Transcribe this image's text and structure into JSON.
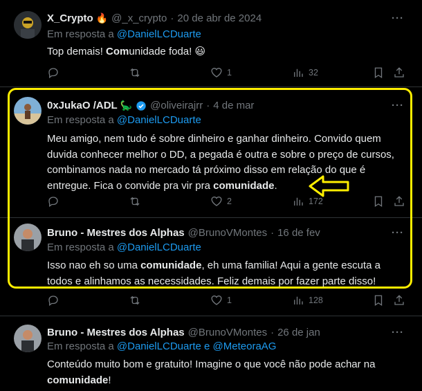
{
  "tweets": [
    {
      "name": "X_Crypto",
      "name_emoji": "🔥",
      "handle": "@_x_crypto",
      "sep": "·",
      "date": "20 de abr de 2024",
      "reply_prefix": "Em resposta a",
      "reply_to": "@DanielLCDuarte",
      "text_pre": "Top demais! ",
      "text_bold": "Com",
      "text_post": "unidade foda! 😃",
      "likes": "1",
      "views": "32"
    },
    {
      "name": "0xJukaO /ADL",
      "name_emoji": "🦕",
      "handle": "@oliveirajrr",
      "sep": "·",
      "date": "4 de mar",
      "reply_prefix": "Em resposta a",
      "reply_to": "@DanielLCDuarte",
      "text_pre": "Meu amigo, nem tudo é sobre dinheiro e ganhar dinheiro. Convido quem duvida conhecer melhor o DD, a pegada é outra e sobre o preço de cursos, combinamos nada no mercado tá próximo disso em relação do que é entregue. Fica o convide pra vir pra ",
      "text_bold": "comunidade",
      "text_post": ".",
      "likes": "2",
      "views": "172"
    },
    {
      "name": "Bruno - Mestres dos Alphas",
      "handle": "@BrunoVMontes",
      "sep": "·",
      "date": "16 de fev",
      "reply_prefix": "Em resposta a",
      "reply_to": "@DanielLCDuarte",
      "text_pre": "Isso nao eh so uma ",
      "text_bold": "comunidade",
      "text_post": ", eh uma familia! Aqui a gente escuta a todos e alinhamos as necessidades. Feliz demais por fazer parte disso!",
      "likes": "1",
      "views": "128"
    },
    {
      "name": "Bruno - Mestres dos Alphas",
      "handle": "@BrunoVMontes",
      "sep": "·",
      "date": "26 de jan",
      "reply_prefix": "Em resposta a",
      "reply_to": "@DanielLCDuarte",
      "reply_and": "e",
      "reply_to_2": "@MeteoraAG",
      "text_pre": "Conteúdo muito bom e gratuito! Imagine o que você não pode achar na ",
      "text_bold": "comunidade",
      "text_post": "!"
    }
  ],
  "more_glyph": "···",
  "colors": {
    "highlight": "#ffee00",
    "link": "#1d9bf0",
    "muted": "#71767b",
    "verified": "#1d9bf0"
  }
}
